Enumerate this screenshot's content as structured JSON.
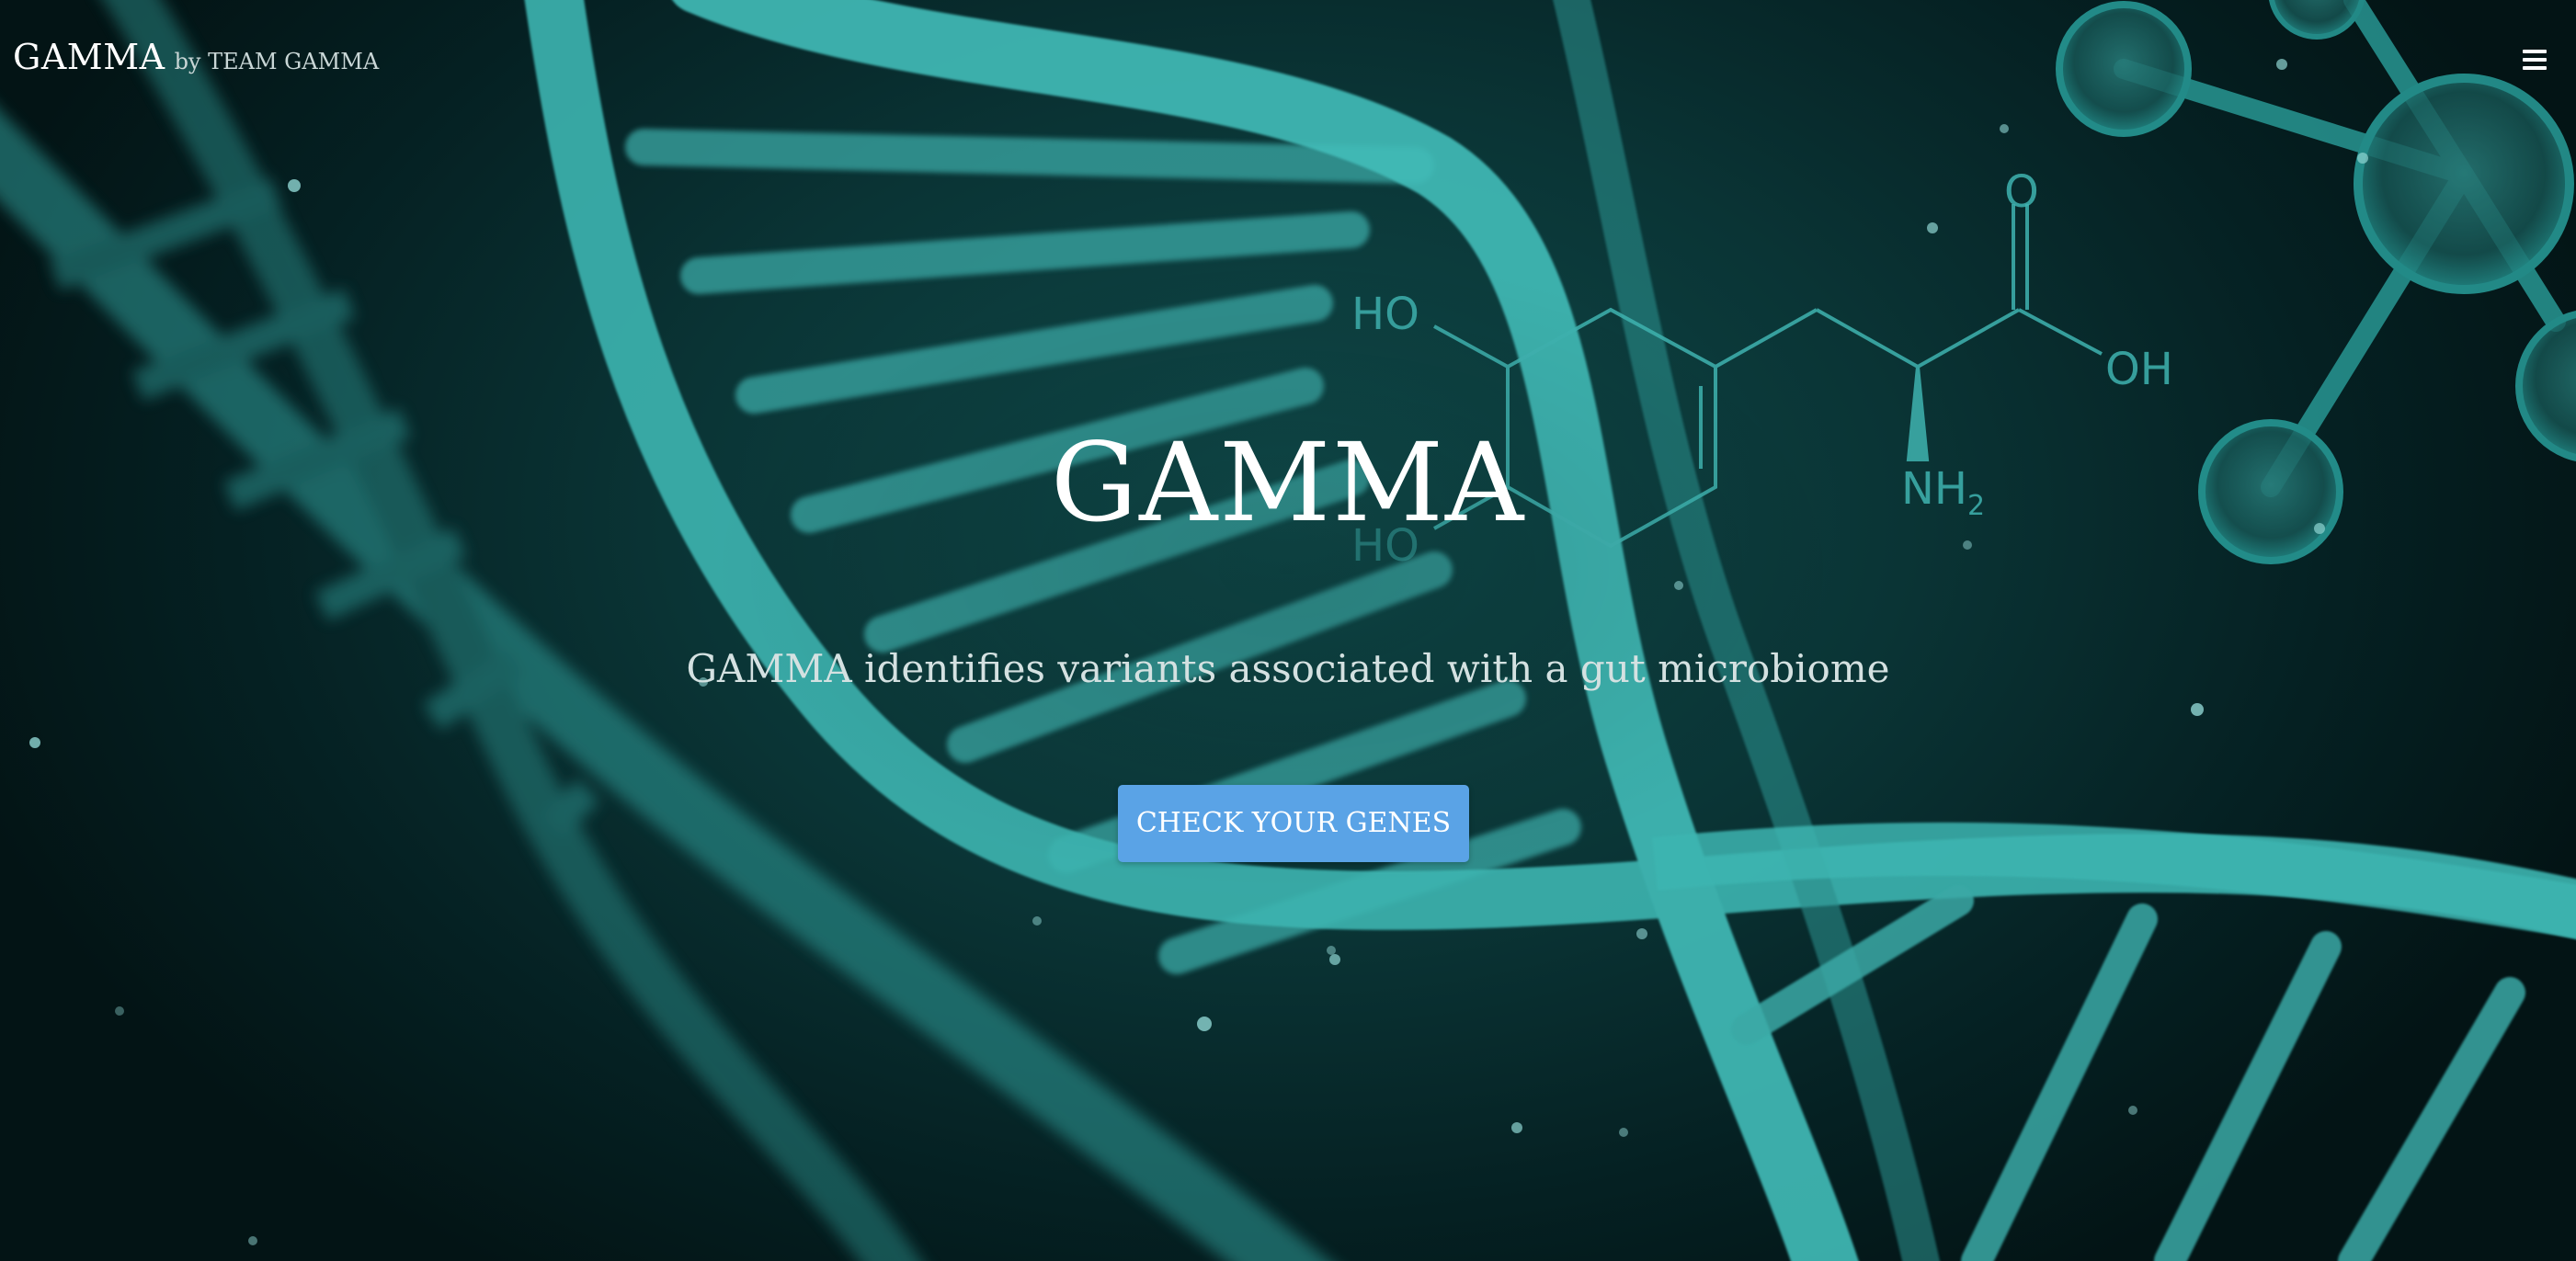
{
  "nav": {
    "brand_name": "GAMMA",
    "brand_sub": "by TEAM GAMMA",
    "menu_icon": "hamburger-menu-icon"
  },
  "hero": {
    "title": "GAMMA",
    "tagline": "GAMMA identifies variants associated with a gut microbiome",
    "cta_label": "CHECK YOUR GENES"
  },
  "background": {
    "molecule_labels": [
      "HO",
      "OH",
      "NH2",
      "O",
      "HO"
    ]
  },
  "colors": {
    "accent": "#5aa3e6",
    "helix": "#3fb3b0",
    "background": "#04191b"
  }
}
